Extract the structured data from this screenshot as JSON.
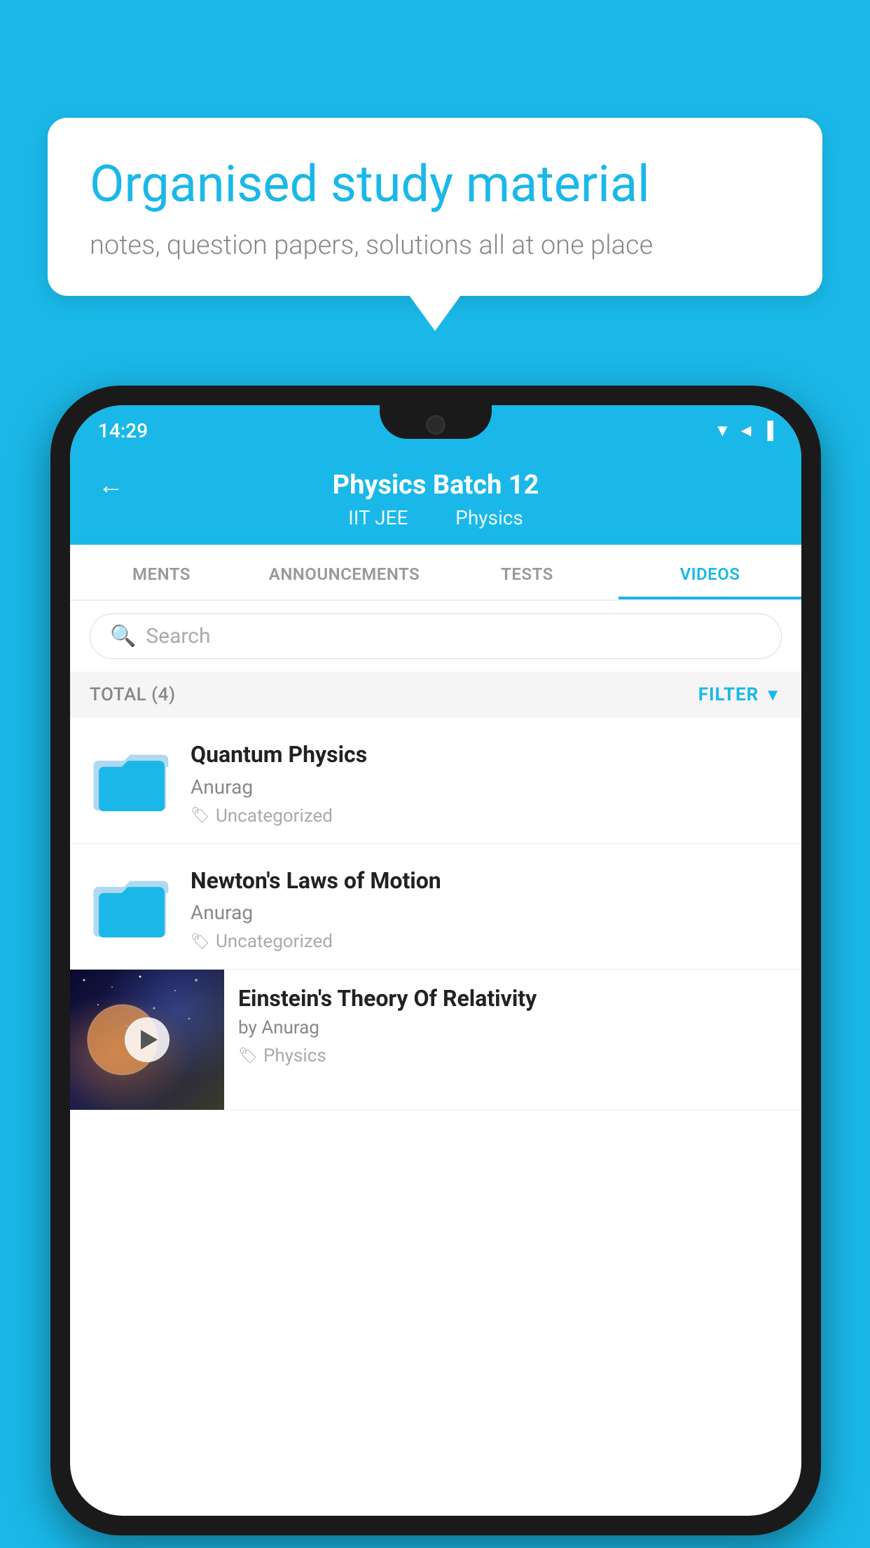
{
  "background_color": "#1ab8e8",
  "speech_bubble": {
    "title": "Organised study material",
    "subtitle": "notes, question papers, solutions all at one place"
  },
  "phone": {
    "status_bar": {
      "time": "14:29",
      "icons": "▼◄▐"
    },
    "header": {
      "title": "Physics Batch 12",
      "tag1": "IIT JEE",
      "tag2": "Physics",
      "back_label": "←"
    },
    "tabs": [
      {
        "label": "MENTS",
        "active": false
      },
      {
        "label": "ANNOUNCEMENTS",
        "active": false
      },
      {
        "label": "TESTS",
        "active": false
      },
      {
        "label": "VIDEOS",
        "active": true
      }
    ],
    "search": {
      "placeholder": "Search"
    },
    "filter_bar": {
      "total_label": "TOTAL (4)",
      "filter_label": "FILTER"
    },
    "video_items": [
      {
        "id": "quantum",
        "type": "folder",
        "title": "Quantum Physics",
        "author": "Anurag",
        "tag": "Uncategorized"
      },
      {
        "id": "newton",
        "type": "folder",
        "title": "Newton's Laws of Motion",
        "author": "Anurag",
        "tag": "Uncategorized"
      },
      {
        "id": "einstein",
        "type": "video",
        "title": "Einstein's Theory Of Relativity",
        "author": "by Anurag",
        "tag": "Physics"
      }
    ]
  }
}
